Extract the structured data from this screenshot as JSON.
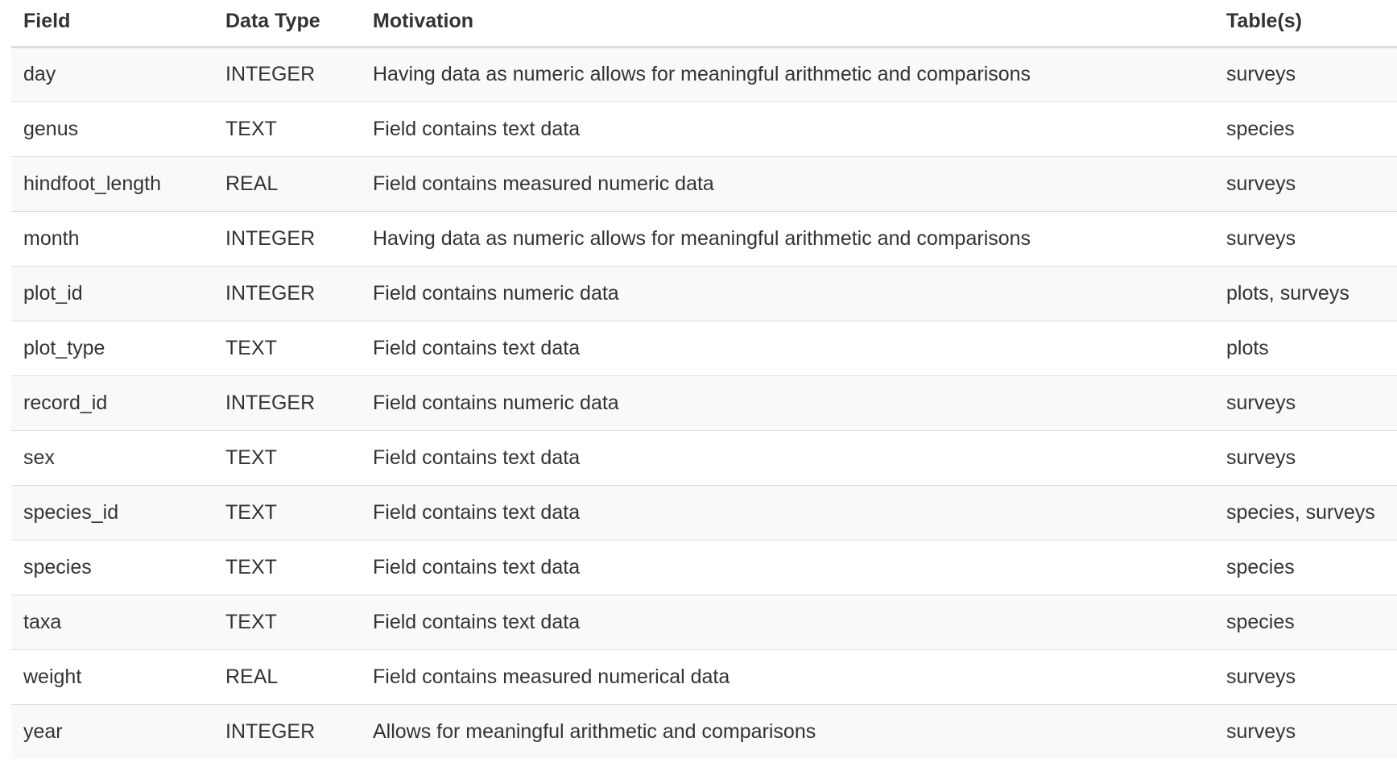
{
  "table": {
    "headers": [
      "Field",
      "Data Type",
      "Motivation",
      "Table(s)"
    ],
    "rows": [
      [
        "day",
        "INTEGER",
        "Having data as numeric allows for meaningful arithmetic and comparisons",
        "surveys"
      ],
      [
        "genus",
        "TEXT",
        "Field contains text data",
        "species"
      ],
      [
        "hindfoot_length",
        "REAL",
        "Field contains measured numeric data",
        "surveys"
      ],
      [
        "month",
        "INTEGER",
        "Having data as numeric allows for meaningful arithmetic and comparisons",
        "surveys"
      ],
      [
        "plot_id",
        "INTEGER",
        "Field contains numeric data",
        "plots, surveys"
      ],
      [
        "plot_type",
        "TEXT",
        "Field contains text data",
        "plots"
      ],
      [
        "record_id",
        "INTEGER",
        "Field contains numeric data",
        "surveys"
      ],
      [
        "sex",
        "TEXT",
        "Field contains text data",
        "surveys"
      ],
      [
        "species_id",
        "TEXT",
        "Field contains text data",
        "species, surveys"
      ],
      [
        "species",
        "TEXT",
        "Field contains text data",
        "species"
      ],
      [
        "taxa",
        "TEXT",
        "Field contains text data",
        "species"
      ],
      [
        "weight",
        "REAL",
        "Field contains measured numerical data",
        "surveys"
      ],
      [
        "year",
        "INTEGER",
        "Allows for meaningful arithmetic and comparisons",
        "surveys"
      ]
    ]
  }
}
